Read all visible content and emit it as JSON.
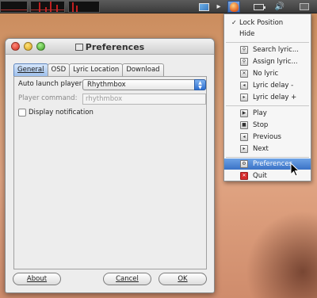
{
  "panel": {
    "tray_icons": [
      "picture-icon",
      "lyric-logo-icon",
      "battery-icon",
      "volume-icon",
      "mail-icon"
    ]
  },
  "window": {
    "title": "Preferences",
    "tabs": [
      {
        "label": "General",
        "active": true
      },
      {
        "label": "OSD",
        "active": false
      },
      {
        "label": "Lyric Location",
        "active": false
      },
      {
        "label": "Download",
        "active": false
      }
    ],
    "auto_launch_label": "Auto launch player:",
    "auto_launch_value": "Rhythmbox",
    "player_command_label": "Player command:",
    "player_command_value": "rhythmbox",
    "display_notification_label": "Display notification",
    "display_notification_checked": false,
    "buttons": {
      "about": "About",
      "cancel": "Cancel",
      "ok": "OK"
    }
  },
  "menu": {
    "items": [
      {
        "label": "Lock Position",
        "checked": true
      },
      {
        "label": "Hide"
      },
      {
        "label": "Search lyric..."
      },
      {
        "label": "Assign lyric..."
      },
      {
        "label": "No lyric"
      },
      {
        "label": "Lyric delay -"
      },
      {
        "label": "Lyric delay +"
      },
      {
        "label": "Play"
      },
      {
        "label": "Stop"
      },
      {
        "label": "Previous"
      },
      {
        "label": "Next"
      },
      {
        "label": "Preferences",
        "highlighted": true
      },
      {
        "label": "Quit"
      }
    ]
  },
  "colors": {
    "highlight": "#3a72c6",
    "active_tab": "#9ec0ec"
  }
}
